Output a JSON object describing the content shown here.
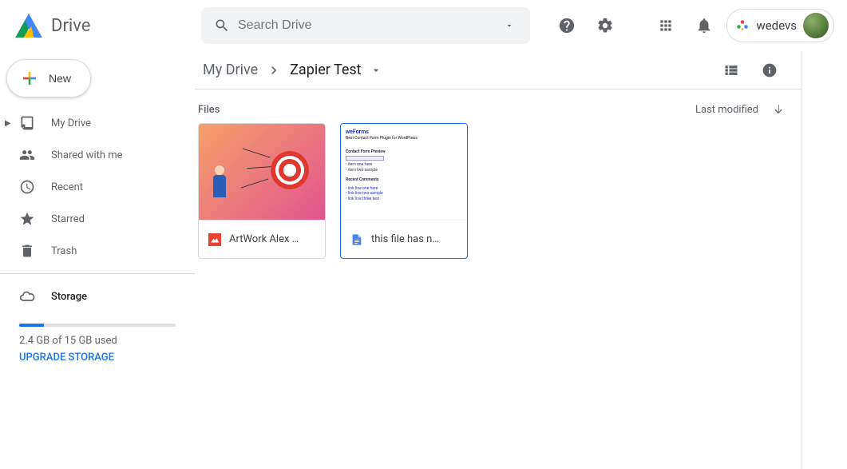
{
  "header": {
    "app_name": "Drive",
    "search_placeholder": "Search Drive",
    "account_brand": "wedevs"
  },
  "sidebar": {
    "new_label": "New",
    "items": [
      {
        "label": "My Drive"
      },
      {
        "label": "Shared with me"
      },
      {
        "label": "Recent"
      },
      {
        "label": "Starred"
      },
      {
        "label": "Trash"
      }
    ],
    "storage": {
      "label": "Storage",
      "used_text": "2.4 GB of 15 GB used",
      "upgrade_label": "UPGRADE STORAGE"
    }
  },
  "breadcrumbs": {
    "root": "My Drive",
    "current": "Zapier Test"
  },
  "content": {
    "section_label": "Files",
    "sort_label": "Last modified",
    "files": [
      {
        "name": "ArtWork Alex …"
      },
      {
        "name": "this file has n…"
      }
    ]
  }
}
